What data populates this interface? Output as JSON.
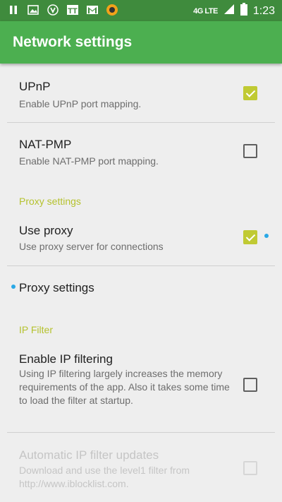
{
  "status_bar": {
    "network": "4G LTE",
    "time": "1:23"
  },
  "app_bar": {
    "title": "Network settings"
  },
  "prefs": {
    "upnp": {
      "title": "UPnP",
      "summary": "Enable UPnP port mapping.",
      "checked": true
    },
    "natpmp": {
      "title": "NAT-PMP",
      "summary": "Enable NAT-PMP port mapping.",
      "checked": false
    },
    "proxy_category": "Proxy settings",
    "use_proxy": {
      "title": "Use proxy",
      "summary": "Use proxy server for connections",
      "checked": true
    },
    "proxy_settings": {
      "title": "Proxy settings"
    },
    "ipfilter_category": "IP Filter",
    "enable_ip_filtering": {
      "title": "Enable IP filtering",
      "summary": "Using IP filtering largely increases the memory requirements of the app. Also it takes some time to load the filter at startup.",
      "checked": false
    },
    "auto_ip_updates": {
      "title": "Automatic IP filter updates",
      "summary": "Download and use the level1 filter from http://www.iblocklist.com.",
      "checked": false,
      "enabled": false
    }
  }
}
